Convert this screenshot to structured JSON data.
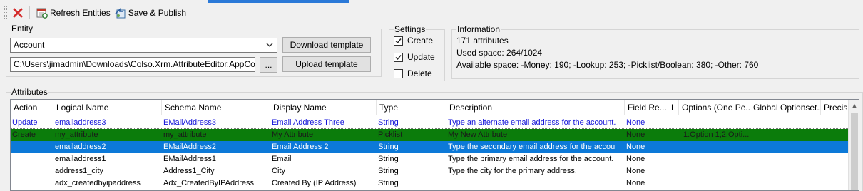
{
  "toolbar": {
    "close_icon": "red-x-icon",
    "refresh_label": "Refresh Entities",
    "refresh_icon": "refresh-entities-icon",
    "publish_label": "Save & Publish",
    "publish_icon": "publish-icon"
  },
  "entity": {
    "group_label": "Entity",
    "selected": "Account",
    "file_path": "C:\\Users\\jimadmin\\Downloads\\Colso.Xrm.AttributeEditor.AppCode.Entit",
    "browse_label": "...",
    "download_label": "Download template",
    "upload_label": "Upload template"
  },
  "settings": {
    "group_label": "Settings",
    "options": [
      {
        "label": "Create",
        "checked": true
      },
      {
        "label": "Update",
        "checked": true
      },
      {
        "label": "Delete",
        "checked": false
      }
    ]
  },
  "information": {
    "group_label": "Information",
    "lines": [
      "171 attributes",
      "Used space: 264/1024",
      "Available space: -Money: 190; -Lookup: 253; -Picklist/Boolean: 380; -Other: 760"
    ]
  },
  "attributes": {
    "group_label": "Attributes",
    "columns": [
      "Action",
      "Logical Name",
      "Schema Name",
      "Display Name",
      "Type",
      "Description",
      "Field Re...",
      "L",
      "Options (One Pe...",
      "Global Optionset...",
      "Precis"
    ],
    "rows": [
      {
        "state": "update",
        "cells": [
          "Update",
          "emailaddress3",
          "EMailAddress3",
          "Email Address Three",
          "String",
          "Type an alternate email address for the account.",
          "None",
          "",
          "",
          "",
          ""
        ]
      },
      {
        "state": "create",
        "cells": [
          "Create",
          "my_attribute",
          "my_attribute",
          "My Attribute",
          "Picklist",
          "My New Attribute",
          "None",
          "",
          "1:Option 1;2:Opti...",
          "",
          ""
        ]
      },
      {
        "state": "selected",
        "cells": [
          "",
          "emailaddress2",
          "EMailAddress2",
          "Email Address 2",
          "String",
          "Type the secondary email address for the accou",
          "None",
          "",
          "",
          "",
          ""
        ]
      },
      {
        "state": "normal",
        "cells": [
          "",
          "emailaddress1",
          "EMailAddress1",
          "Email",
          "String",
          "Type the primary email address for the account.",
          "None",
          "",
          "",
          "",
          ""
        ]
      },
      {
        "state": "normal",
        "cells": [
          "",
          "address1_city",
          "Address1_City",
          "City",
          "String",
          "Type the city for the primary address.",
          "None",
          "",
          "",
          "",
          ""
        ]
      },
      {
        "state": "normal",
        "cells": [
          "",
          "adx_createdbyipaddress",
          "Adx_CreatedByIPAddress",
          "Created By (IP Address)",
          "String",
          "",
          "None",
          "",
          "",
          "",
          ""
        ]
      }
    ],
    "colors": {
      "update": "#1414d8",
      "create": "#0b7c0b",
      "selected": "#0c79d8"
    }
  }
}
